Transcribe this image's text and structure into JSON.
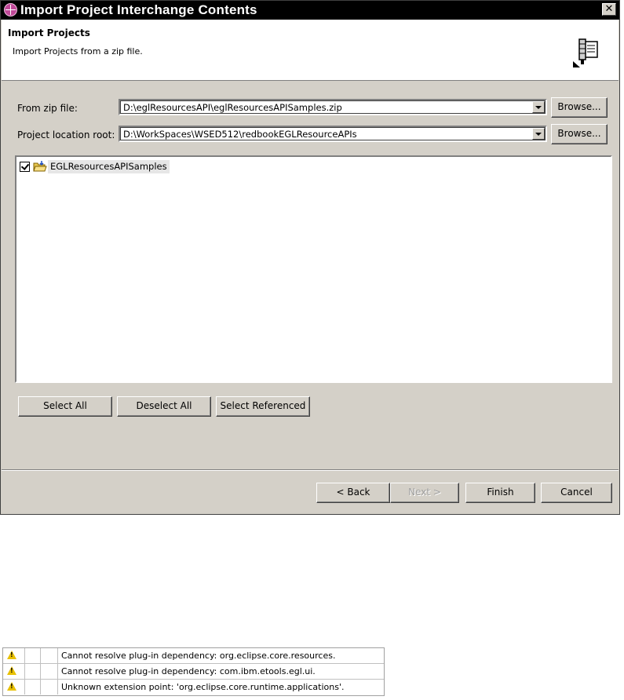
{
  "dialog": {
    "title": "Import Project Interchange Contents",
    "close_glyph": "✕",
    "banner": {
      "heading": "Import Projects",
      "description": "Import Projects from a zip file."
    },
    "zip_file": {
      "label": "From zip file:",
      "value": "D:\\eglResourcesAPI\\eglResourcesAPISamples.zip",
      "browse_label": "Browse..."
    },
    "location_root": {
      "label": "Project location root:",
      "value": "D:\\WorkSpaces\\WSED512\\redbookEGLResourceAPIs",
      "browse_label": "Browse..."
    },
    "projects": [
      {
        "name": "EGLResourcesAPISamples",
        "checked": true
      }
    ],
    "selection_buttons": {
      "select_all": "Select All",
      "deselect_all": "Deselect All",
      "select_referenced": "Select Referenced"
    },
    "footer": {
      "back": "< Back",
      "next": "Next >",
      "finish": "Finish",
      "cancel": "Cancel"
    }
  },
  "problems": [
    {
      "icon": "warning-icon",
      "message": "Cannot resolve plug-in dependency: org.eclipse.core.resources."
    },
    {
      "icon": "warning-icon",
      "message": "Cannot resolve plug-in dependency: com.ibm.etools.egl.ui."
    },
    {
      "icon": "warning-icon",
      "message": "Unknown extension point: 'org.eclipse.core.runtime.applications'."
    }
  ],
  "colors": {
    "dialog_face": "#d4d0c8",
    "title_bar": "#000000",
    "warning": "#e8c000"
  }
}
